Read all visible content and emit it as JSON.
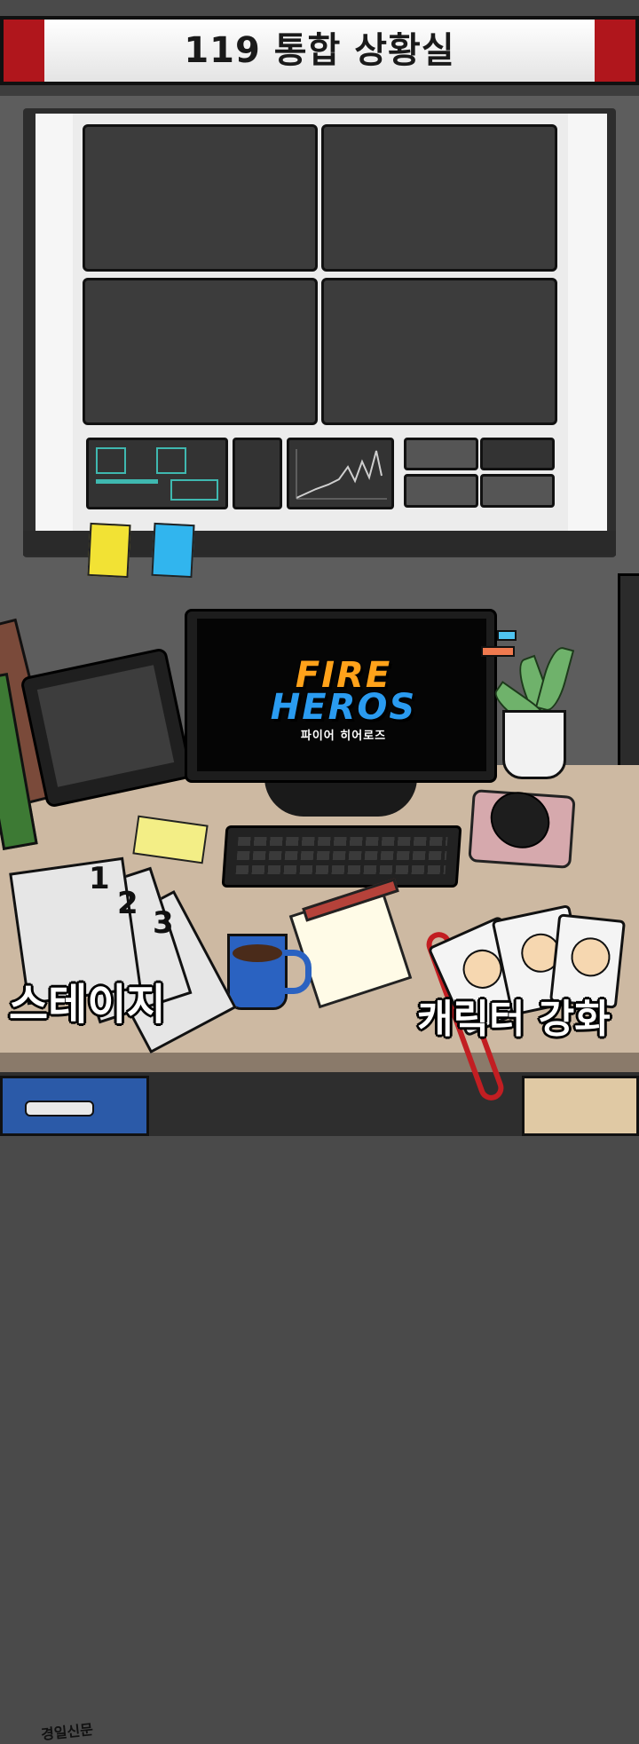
{
  "header": {
    "title": "119 통합 상황실"
  },
  "computer": {
    "logo_line1": "FIRE",
    "logo_line2": "HEROS",
    "logo_subtitle": "파이어 히어로즈"
  },
  "newspaper": {
    "masthead": "경일신문",
    "numbers": [
      "1",
      "2",
      "3"
    ]
  },
  "menu": {
    "stage_label": "스테이지",
    "upgrade_label": "캐릭터 강화"
  },
  "colors": {
    "banner_red": "#b0161c",
    "logo_orange": "#ffa21a",
    "logo_blue": "#2a9bf0",
    "cup_blue": "#2a62c1",
    "lanyard_red": "#c21e22"
  }
}
